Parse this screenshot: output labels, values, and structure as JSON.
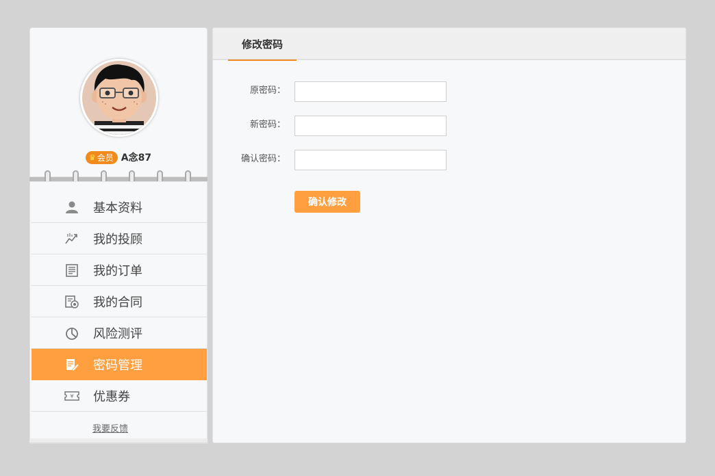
{
  "profile": {
    "vip_label": "会员",
    "username": "A念87"
  },
  "sidebar": {
    "items": [
      {
        "label": "基本资料",
        "icon": "user-icon"
      },
      {
        "label": "我的投顾",
        "icon": "trend-chart-icon"
      },
      {
        "label": "我的订单",
        "icon": "order-list-icon"
      },
      {
        "label": "我的合同",
        "icon": "contract-icon"
      },
      {
        "label": "风险测评",
        "icon": "pie-chart-icon"
      },
      {
        "label": "密码管理",
        "icon": "edit-document-icon",
        "active": true
      },
      {
        "label": "优惠券",
        "icon": "coupon-icon"
      }
    ],
    "feedback": "我要反馈"
  },
  "main": {
    "tab_title": "修改密码",
    "form": {
      "old_password_label": "原密码：",
      "new_password_label": "新密码：",
      "confirm_password_label": "确认密码：",
      "old_password_value": "",
      "new_password_value": "",
      "confirm_password_value": "",
      "submit_label": "确认修改"
    }
  },
  "colors": {
    "accent": "#ff9f40",
    "tab_underline": "#f28b1e",
    "background": "#d3d3d3"
  }
}
